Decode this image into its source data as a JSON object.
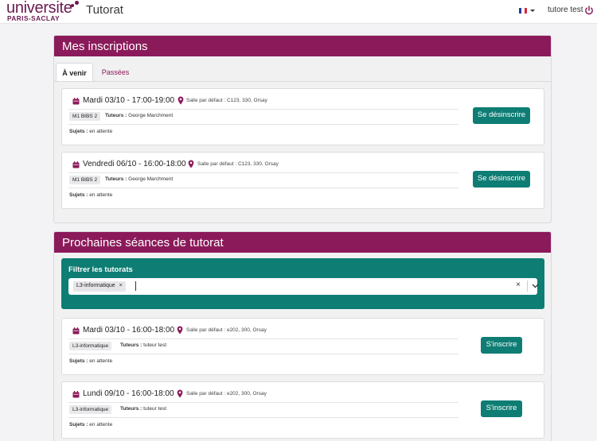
{
  "header": {
    "logo_main": "universite",
    "logo_sub": "PARIS-SACLAY",
    "app_title": "Tutorat",
    "user_name": "tutore test"
  },
  "registrations": {
    "title": "Mes inscriptions",
    "tabs": [
      {
        "label": "À venir",
        "active": true
      },
      {
        "label": "Passées",
        "active": false
      }
    ],
    "sessions": [
      {
        "date": "Mardi 03/10 - 17:00-19:00",
        "room": "Salle par défaut : C123, 330, Orsay",
        "level": "M1 BIBS 2",
        "tutors_label": "Tuteurs :",
        "tutors": "George Marchment",
        "subjects_label": "Sujets :",
        "subjects": "en attente",
        "button": "Se désinscrire"
      },
      {
        "date": "Vendredi 06/10 - 16:00-18:00",
        "room": "Salle par défaut : C123, 330, Orsay",
        "level": "M1 BIBS 2",
        "tutors_label": "Tuteurs :",
        "tutors": "George Marchment",
        "subjects_label": "Sujets :",
        "subjects": "en attente",
        "button": "Se désinscrire"
      }
    ]
  },
  "upcoming": {
    "title": "Prochaines séances de tutorat",
    "filter": {
      "label": "Filtrer les tutorats",
      "selected_chip": "L3-informatique",
      "chip_remove": "×",
      "clear": "×"
    },
    "sessions": [
      {
        "date": "Mardi 03/10 - 16:00-18:00",
        "room": "Salle par défaut : e202, 300, Orsay",
        "level": "L3-informatique",
        "tutors_label": "Tuteurs :",
        "tutors": "tuteur test",
        "subjects_label": "Sujets :",
        "subjects": "en attente",
        "button": "S'inscrire"
      },
      {
        "date": "Lundi 09/10 - 16:00-18:00",
        "room": "Salle par défaut : e202, 300, Orsay",
        "level": "L3-informatique",
        "tutors_label": "Tuteurs :",
        "tutors": "tuteur test",
        "subjects_label": "Sujets :",
        "subjects": "en attente",
        "button": "S'inscrire"
      }
    ]
  },
  "colors": {
    "brand": "#8b1a5a",
    "accent": "#0e7d74",
    "flag_blue": "#1f3fa0",
    "flag_white": "#ffffff",
    "flag_red": "#d7263d"
  },
  "icons": {
    "calendar": "calendar-icon",
    "location": "map-pin-icon",
    "power": "power-icon",
    "flag": "french-flag-icon",
    "chevron": "chevron-down-icon"
  }
}
